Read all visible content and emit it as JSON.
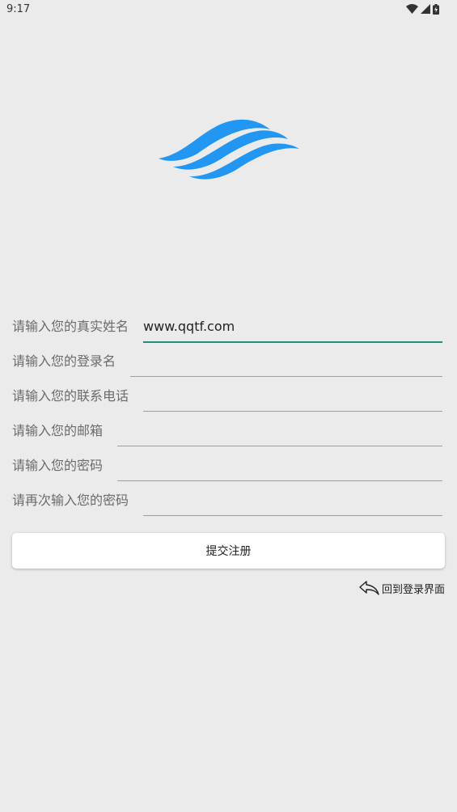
{
  "status_bar": {
    "time": "9:17"
  },
  "logo": {
    "color": "#2196f3"
  },
  "form": {
    "fields": [
      {
        "label": "请输入您的真实姓名",
        "value": "www.qqtf.com"
      },
      {
        "label": "请输入您的登录名",
        "value": ""
      },
      {
        "label": "请输入您的联系电话",
        "value": ""
      },
      {
        "label": "请输入您的邮箱",
        "value": ""
      },
      {
        "label": "请输入您的密码",
        "value": ""
      },
      {
        "label": "请再次输入您的密码",
        "value": ""
      }
    ],
    "submit_label": "提交注册",
    "back_label": "回到登录界面"
  },
  "colors": {
    "accent": "#1f8a86",
    "background": "#ebebeb"
  }
}
